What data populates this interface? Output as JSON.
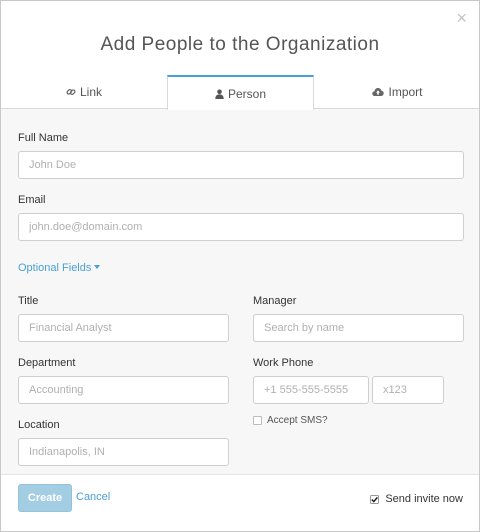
{
  "title": "Add People to the Organization",
  "close_glyph": "×",
  "tabs": [
    {
      "label": "Link",
      "icon": "link-icon"
    },
    {
      "label": "Person",
      "icon": "user-icon",
      "active": true
    },
    {
      "label": "Import",
      "icon": "cloud-upload-icon"
    }
  ],
  "fields": {
    "full_name": {
      "label": "Full Name",
      "placeholder": "John Doe"
    },
    "email": {
      "label": "Email",
      "placeholder": "john.doe@domain.com"
    },
    "title": {
      "label": "Title",
      "placeholder": "Financial Analyst"
    },
    "manager": {
      "label": "Manager",
      "placeholder": "Search by name"
    },
    "department": {
      "label": "Department",
      "placeholder": "Accounting"
    },
    "work_phone": {
      "label": "Work Phone",
      "placeholder": "+1 555-555-5555",
      "ext_placeholder": "x123"
    },
    "location": {
      "label": "Location",
      "placeholder": "Indianapolis, IN"
    }
  },
  "optional_fields_label": "Optional Fields",
  "accept_sms_label": "Accept SMS?",
  "accept_sms_checked": false,
  "footer": {
    "create_label": "Create",
    "cancel_label": "Cancel",
    "send_invite_label": "Send invite now",
    "send_invite_checked": true
  },
  "colors": {
    "accent": "#4a9fd4",
    "create_button": "#a3cde3",
    "body_background": "#f7f7f7"
  }
}
